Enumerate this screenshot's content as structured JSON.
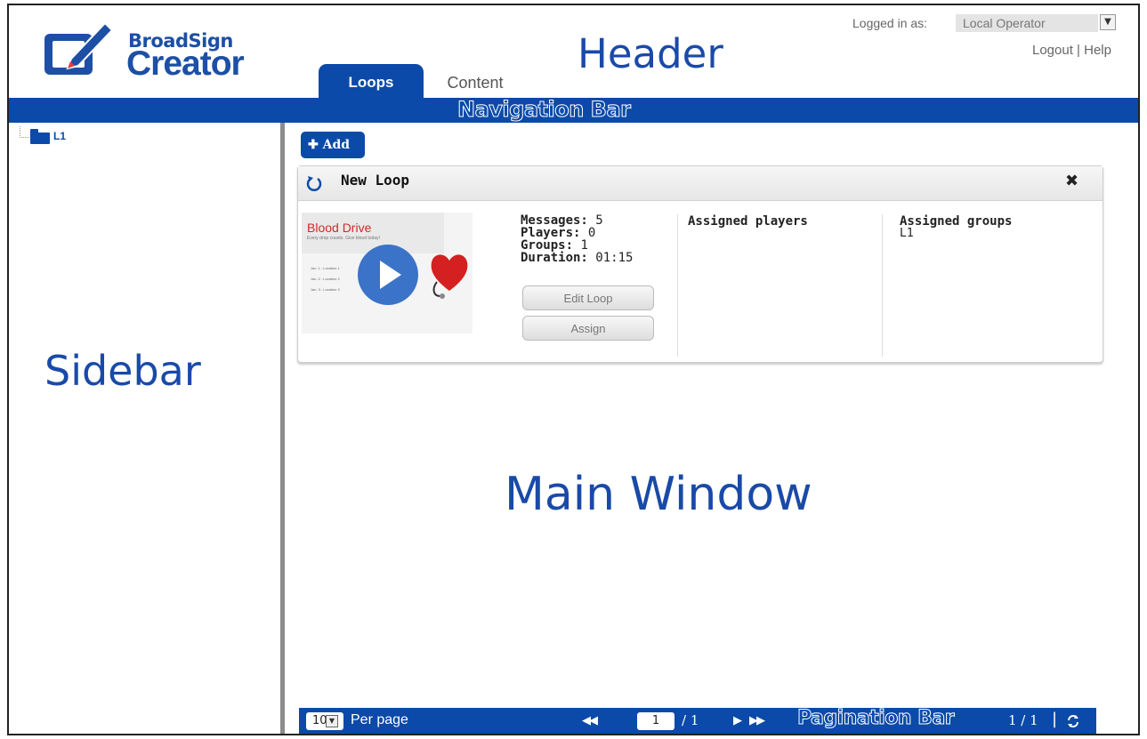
{
  "header": {
    "brand_top": "BroadSign",
    "brand_main": "Creator",
    "label": "Header",
    "login_label": "Logged in as:",
    "operator": "Local Operator",
    "links": "Logout | Help"
  },
  "tabs": [
    {
      "label": "Loops",
      "active": true
    },
    {
      "label": "Content",
      "active": false
    }
  ],
  "navbar": {
    "label": "Navigation Bar"
  },
  "sidebar": {
    "label": "Sidebar",
    "tree": [
      {
        "label": "L1"
      }
    ]
  },
  "main": {
    "label": "Main Window",
    "add_label": "Add",
    "card": {
      "title": "New Loop",
      "close": "✖",
      "thumbnail": {
        "title": "Blood Drive",
        "subtitle": "Every drop counts. Give blood today!",
        "lines": [
          "Jan. 1 : Location 1",
          "Jan. 2 : Location 2",
          "Jan. 3 : Location 3"
        ]
      },
      "stats": {
        "messages_label": "Messages:",
        "messages": "5",
        "players_label": "Players:",
        "players": "0",
        "groups_label": "Groups:",
        "groups": "1",
        "duration_label": "Duration:",
        "duration": "01:15"
      },
      "edit_label": "Edit Loop",
      "assign_label": "Assign",
      "assigned_players_title": "Assigned players",
      "assigned_groups_title": "Assigned groups",
      "assigned_groups_value": "L1"
    }
  },
  "pagination": {
    "label": "Pagination Bar",
    "per_page_value": "10",
    "per_page_label": "Per page",
    "page": "1",
    "total_pages": "/ 1",
    "range": "1 / 1",
    "separator": "|"
  },
  "colors": {
    "brand_blue": "#0b4aa8",
    "heading_blue": "#1a4aa8",
    "red": "#d62828"
  }
}
